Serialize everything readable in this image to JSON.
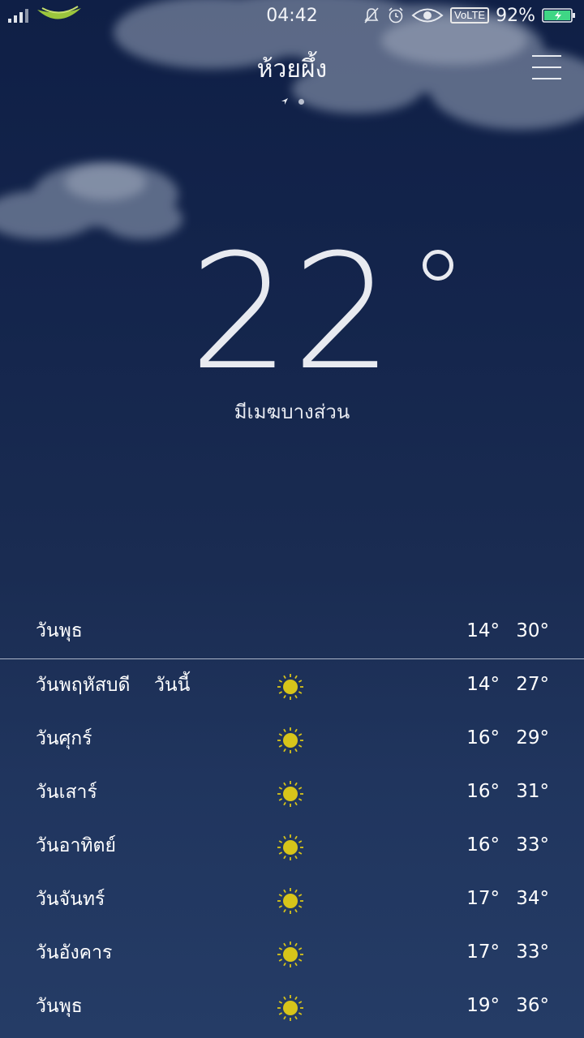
{
  "status_bar": {
    "time": "04:42",
    "volte": "VoLTE",
    "battery": "92%"
  },
  "header": {
    "city": "ห้วยผึ้ง"
  },
  "current": {
    "temperature": "22",
    "condition": "มีเมฆบางส่วน"
  },
  "today_row": {
    "day": "วันพุธ",
    "low": "14°",
    "high": "30°"
  },
  "forecast": [
    {
      "day": "วันพฤหัสบดี",
      "tag": "วันนี้",
      "icon": "sun-icon",
      "low": "14°",
      "high": "27°"
    },
    {
      "day": "วันศุกร์",
      "tag": "",
      "icon": "sun-icon",
      "low": "16°",
      "high": "29°"
    },
    {
      "day": "วันเสาร์",
      "tag": "",
      "icon": "sun-icon",
      "low": "16°",
      "high": "31°"
    },
    {
      "day": "วันอาทิตย์",
      "tag": "",
      "icon": "sun-icon",
      "low": "16°",
      "high": "33°"
    },
    {
      "day": "วันจันทร์",
      "tag": "",
      "icon": "sun-icon",
      "low": "17°",
      "high": "34°"
    },
    {
      "day": "วันอังคาร",
      "tag": "",
      "icon": "sun-icon",
      "low": "17°",
      "high": "33°"
    },
    {
      "day": "วันพุธ",
      "tag": "",
      "icon": "sun-icon",
      "low": "19°",
      "high": "36°"
    }
  ],
  "colors": {
    "background_top": "#0f1f46",
    "background_bottom": "#253c66",
    "sun": "#d7c41a",
    "battery": "#3fd685"
  }
}
